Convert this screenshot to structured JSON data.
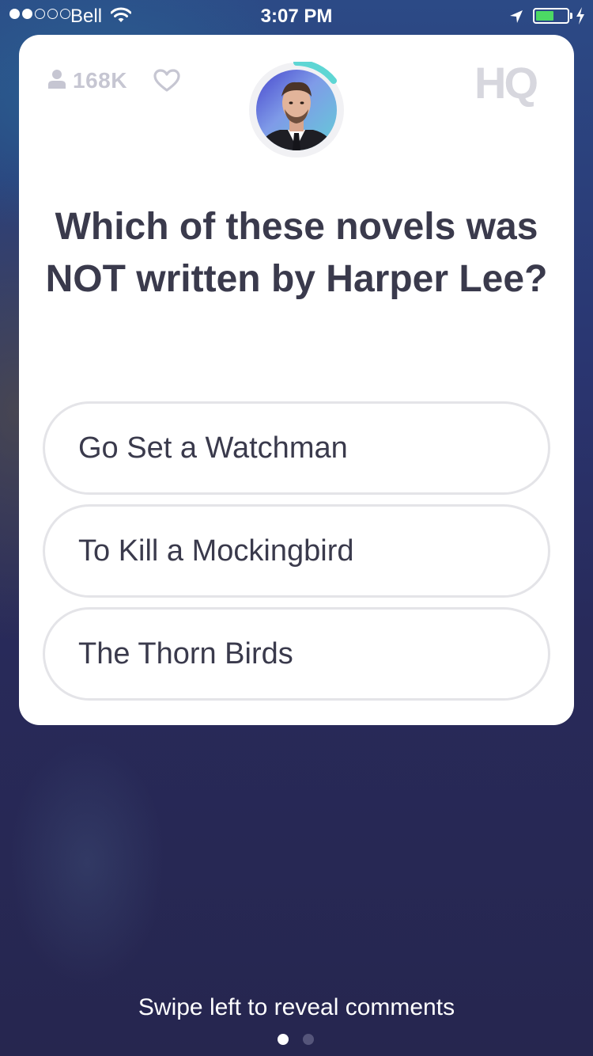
{
  "status_bar": {
    "carrier": "Bell",
    "time": "3:07 PM",
    "signal_strength": 2,
    "signal_max": 5,
    "battery_level": 0.55,
    "battery_color": "#4cd964",
    "icons": [
      "wifi-icon",
      "location-arrow-icon",
      "battery-icon",
      "charging-bolt-icon"
    ]
  },
  "header": {
    "viewer_count": "168K",
    "viewer_icon": "person-icon",
    "like_icon": "heart-icon",
    "logo_text": "HQ",
    "host_timer_color": "#5ed6d4"
  },
  "question": {
    "text": "Which of these novels was NOT written by Harper Lee?"
  },
  "answers": [
    {
      "label": "Go Set a Watchman"
    },
    {
      "label": "To Kill a Mockingbird"
    },
    {
      "label": "The Thorn Birds"
    }
  ],
  "footer": {
    "hint": "Swipe left to reveal comments",
    "page_count": 2,
    "active_page": 1
  },
  "colors": {
    "text_dark": "#3a3a4c",
    "muted": "#c6c6d2",
    "answer_border": "#e4e4e8",
    "background": "#272750"
  }
}
